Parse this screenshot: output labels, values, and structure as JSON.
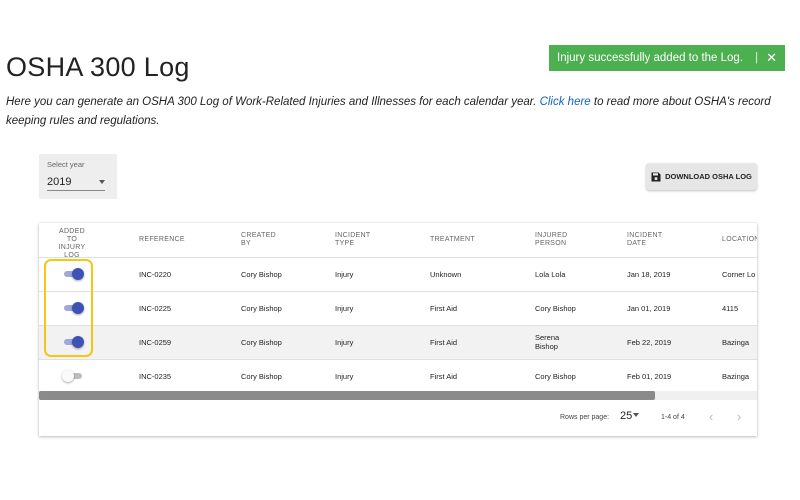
{
  "toast": {
    "message": "Injury successfully added to the Log.",
    "separator": "|",
    "close": "✕",
    "color": "#4caf50"
  },
  "page": {
    "title": "OSHA 300 Log",
    "intro_before": "Here you can generate an OSHA 300 Log of Work-Related Injuries and Illnesses for each calendar year. ",
    "intro_link": "Click here",
    "intro_after": " to read more about OSHA's record keeping rules and regulations."
  },
  "year_select": {
    "label": "Select year",
    "value": "2019"
  },
  "download_button": {
    "label": "DOWNLOAD OSHA LOG",
    "icon": "save-icon"
  },
  "table": {
    "headers": {
      "added": "ADDED TO INJURY LOG",
      "reference": "REFERENCE",
      "created_by": "CREATED BY",
      "incident_type": "INCIDENT TYPE",
      "treatment": "TREATMENT",
      "injured_person": "INJURED PERSON",
      "incident_date": "INCIDENT DATE",
      "location": "LOCATION"
    },
    "rows": [
      {
        "added": true,
        "reference": "INC-0220",
        "created_by": "Cory Bishop",
        "incident_type": "Injury",
        "treatment": "Unknown",
        "injured_person": "Lola Lola",
        "incident_date": "Jan 18, 2019",
        "location": "Corner Lo"
      },
      {
        "added": true,
        "reference": "INC-0225",
        "created_by": "Cory Bishop",
        "incident_type": "Injury",
        "treatment": "First Aid",
        "injured_person": "Cory Bishop",
        "incident_date": "Jan 01, 2019",
        "location": "4115"
      },
      {
        "added": true,
        "reference": "INC-0259",
        "created_by": "Cory Bishop",
        "incident_type": "Injury",
        "treatment": "First Aid",
        "injured_person": "Serena Bishop",
        "incident_date": "Feb 22, 2019",
        "location": "Bazinga"
      },
      {
        "added": false,
        "reference": "INC-0235",
        "created_by": "Cory Bishop",
        "incident_type": "Injury",
        "treatment": "First Aid",
        "injured_person": "Cory Bishop",
        "incident_date": "Feb 01, 2019",
        "location": "Bazinga"
      }
    ]
  },
  "pagination": {
    "rows_per_page_label": "Rows per page:",
    "rows_per_page": "25",
    "range": "1-4 of 4",
    "prev": "‹",
    "next": "›"
  },
  "colors": {
    "toggle_on": "#3f51b5",
    "highlight": "#f5c518",
    "link": "#1565c0"
  }
}
